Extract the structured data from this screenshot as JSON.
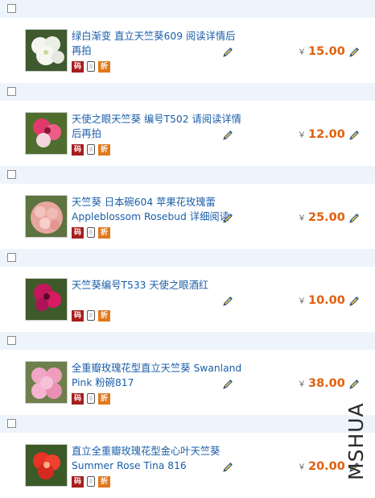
{
  "icons": {
    "ma": "码",
    "zhe": "折",
    "currency": "￥"
  },
  "watermark": "MSHUA",
  "items": [
    {
      "title1": "绿白渐变 直立天竺葵609 阅读详情后",
      "title2": "再拍",
      "price": "15.00"
    },
    {
      "title1": "天使之眼天竺葵 编号T502 请阅读详情",
      "title2": "后再拍",
      "price": "12.00"
    },
    {
      "title1": "天竺葵 日本碗604 苹果花玫瑰蕾",
      "title2": "Appleblossom Rosebud 详细阅读",
      "price": "25.00"
    },
    {
      "title1": "天竺葵编号T533 天使之眼酒红",
      "title2": "",
      "price": "10.00"
    },
    {
      "title1": "全重瓣玫瑰花型直立天竺葵 Swanland",
      "title2": "Pink 粉碗817",
      "price": "38.00"
    },
    {
      "title1": "直立全重瓣玫瑰花型金心叶天竺葵",
      "title2": "Summer Rose Tina 816",
      "price": "20.00"
    }
  ]
}
